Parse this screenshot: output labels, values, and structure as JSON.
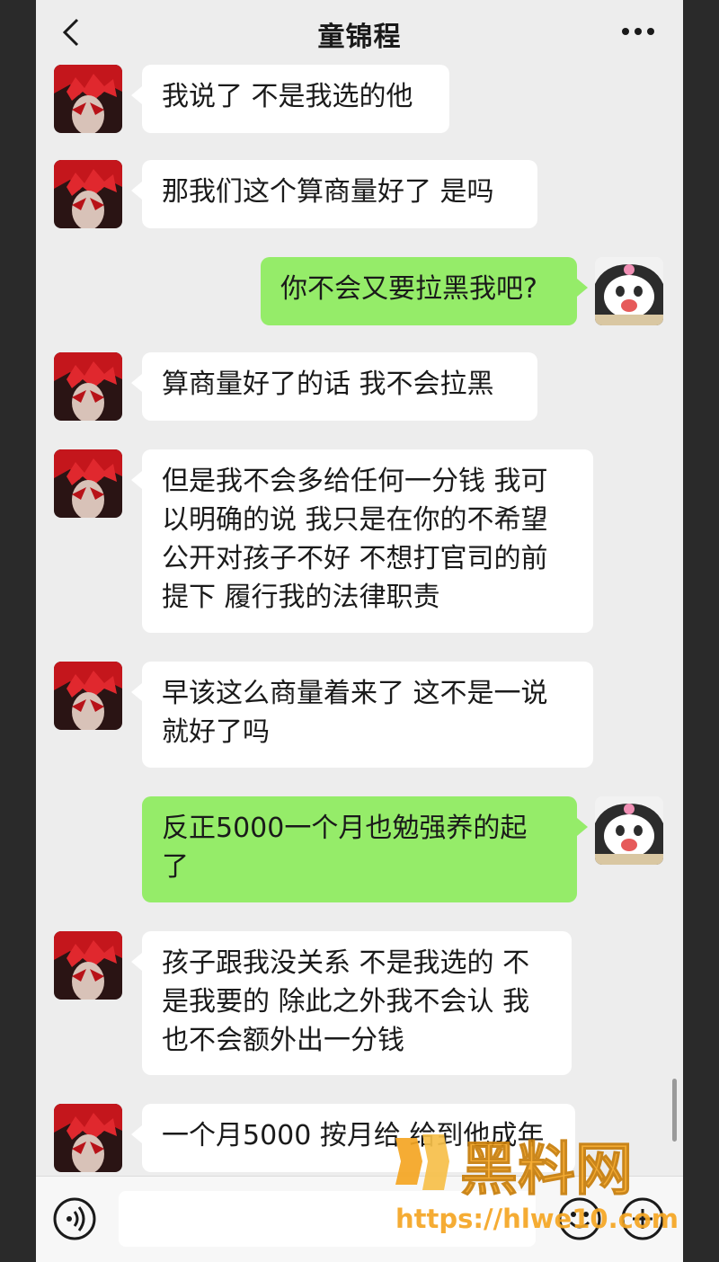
{
  "header": {
    "title": "童锦程",
    "back_icon": "chevron-left-icon",
    "more_icon": "more-dots-icon"
  },
  "messages": [
    {
      "side": "in",
      "text": "我说了 不是我选的他"
    },
    {
      "side": "in",
      "text": "那我们这个算商量好了 是吗"
    },
    {
      "side": "out",
      "text": "你不会又要拉黑我吧?"
    },
    {
      "side": "in",
      "text": "算商量好了的话 我不会拉黑"
    },
    {
      "side": "in",
      "text": "但是我不会多给任何一分钱 我可\n以明确的说 我只是在你的不希望\n公开对孩子不好 不想打官司的前\n提下 履行我的法律职责"
    },
    {
      "side": "in",
      "text": "早该这么商量着来了 这不是一说\n就好了吗"
    },
    {
      "side": "out",
      "text": "反正5000一个月也勉强养的起\n了"
    },
    {
      "side": "in",
      "text": "孩子跟我没关系 不是我选的 不\n是我要的 除此之外我不会认 我\n也不会额外出一分钱"
    },
    {
      "side": "in",
      "text": "一个月5000 按月给 给到他成年"
    }
  ],
  "bottom_bar": {
    "voice_icon": "voice-icon",
    "emoji_icon": "emoji-icon",
    "plus_icon": "plus-icon"
  },
  "watermark": {
    "text": "黑料网",
    "url": "https://hlwe10.com"
  },
  "colors": {
    "incoming_bubble": "#ffffff",
    "outgoing_bubble": "#95ec69",
    "background": "#ededed",
    "watermark": "#f5a623"
  }
}
